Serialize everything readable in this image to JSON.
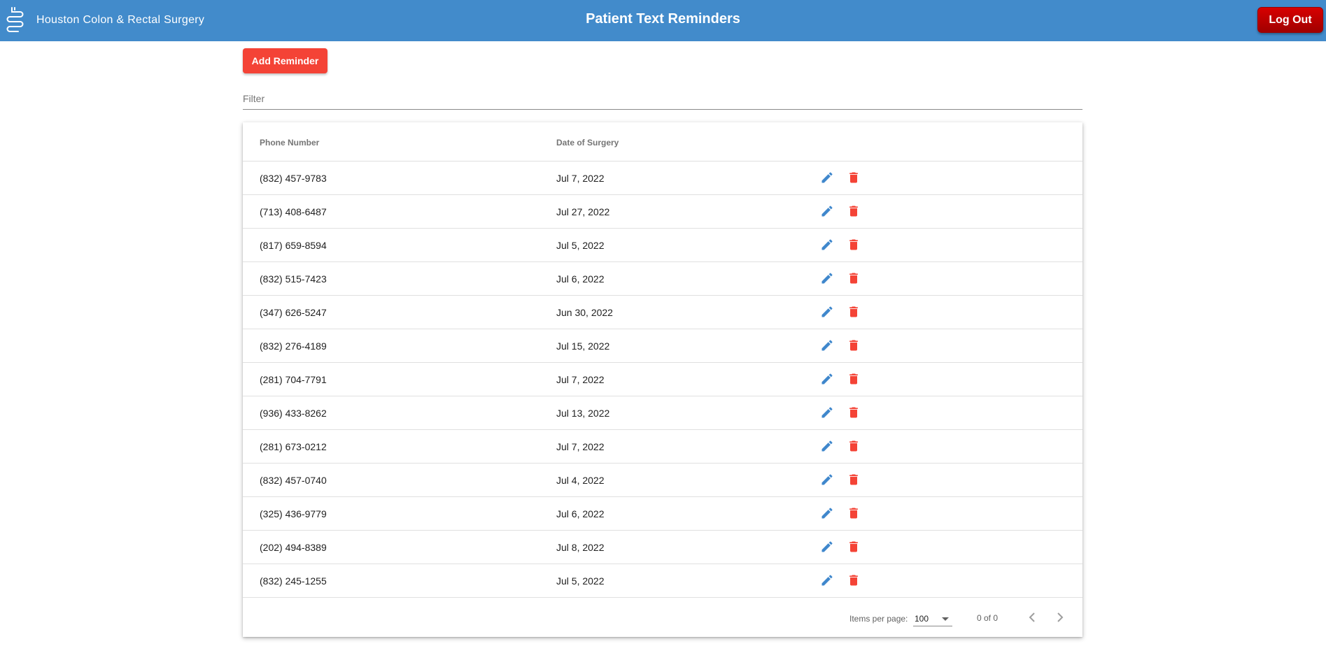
{
  "header": {
    "brand_name": "Houston Colon & Rectal Surgery",
    "title": "Patient Text Reminders",
    "logout_label": "Log Out"
  },
  "toolbar": {
    "add_label": "Add Reminder"
  },
  "filter": {
    "placeholder": "Filter",
    "value": ""
  },
  "table": {
    "columns": [
      "Phone Number",
      "Date of Surgery"
    ],
    "rows": [
      {
        "phone": "(832) 457-9783",
        "date": "Jul 7, 2022"
      },
      {
        "phone": "(713) 408-6487",
        "date": "Jul 27, 2022"
      },
      {
        "phone": "(817) 659-8594",
        "date": "Jul 5, 2022"
      },
      {
        "phone": "(832) 515-7423",
        "date": "Jul 6, 2022"
      },
      {
        "phone": "(347) 626-5247",
        "date": "Jun 30, 2022"
      },
      {
        "phone": "(832) 276-4189",
        "date": "Jul 15, 2022"
      },
      {
        "phone": "(281) 704-7791",
        "date": "Jul 7, 2022"
      },
      {
        "phone": "(936) 433-8262",
        "date": "Jul 13, 2022"
      },
      {
        "phone": "(281) 673-0212",
        "date": "Jul 7, 2022"
      },
      {
        "phone": "(832) 457-0740",
        "date": "Jul 4, 2022"
      },
      {
        "phone": "(325) 436-9779",
        "date": "Jul 6, 2022"
      },
      {
        "phone": "(202) 494-8389",
        "date": "Jul 8, 2022"
      },
      {
        "phone": "(832) 245-1255",
        "date": "Jul 5, 2022"
      }
    ],
    "row_actions": {
      "edit_icon": "pencil-icon",
      "delete_icon": "trash-icon"
    }
  },
  "paginator": {
    "items_per_page_label": "Items per page:",
    "items_per_page_value": "100",
    "range_label": "0 of 0"
  },
  "colors": {
    "header_bg": "#428bcb",
    "accent_red": "#f44336",
    "edit_blue": "#3f87cc",
    "logout_red": "#c00000"
  }
}
